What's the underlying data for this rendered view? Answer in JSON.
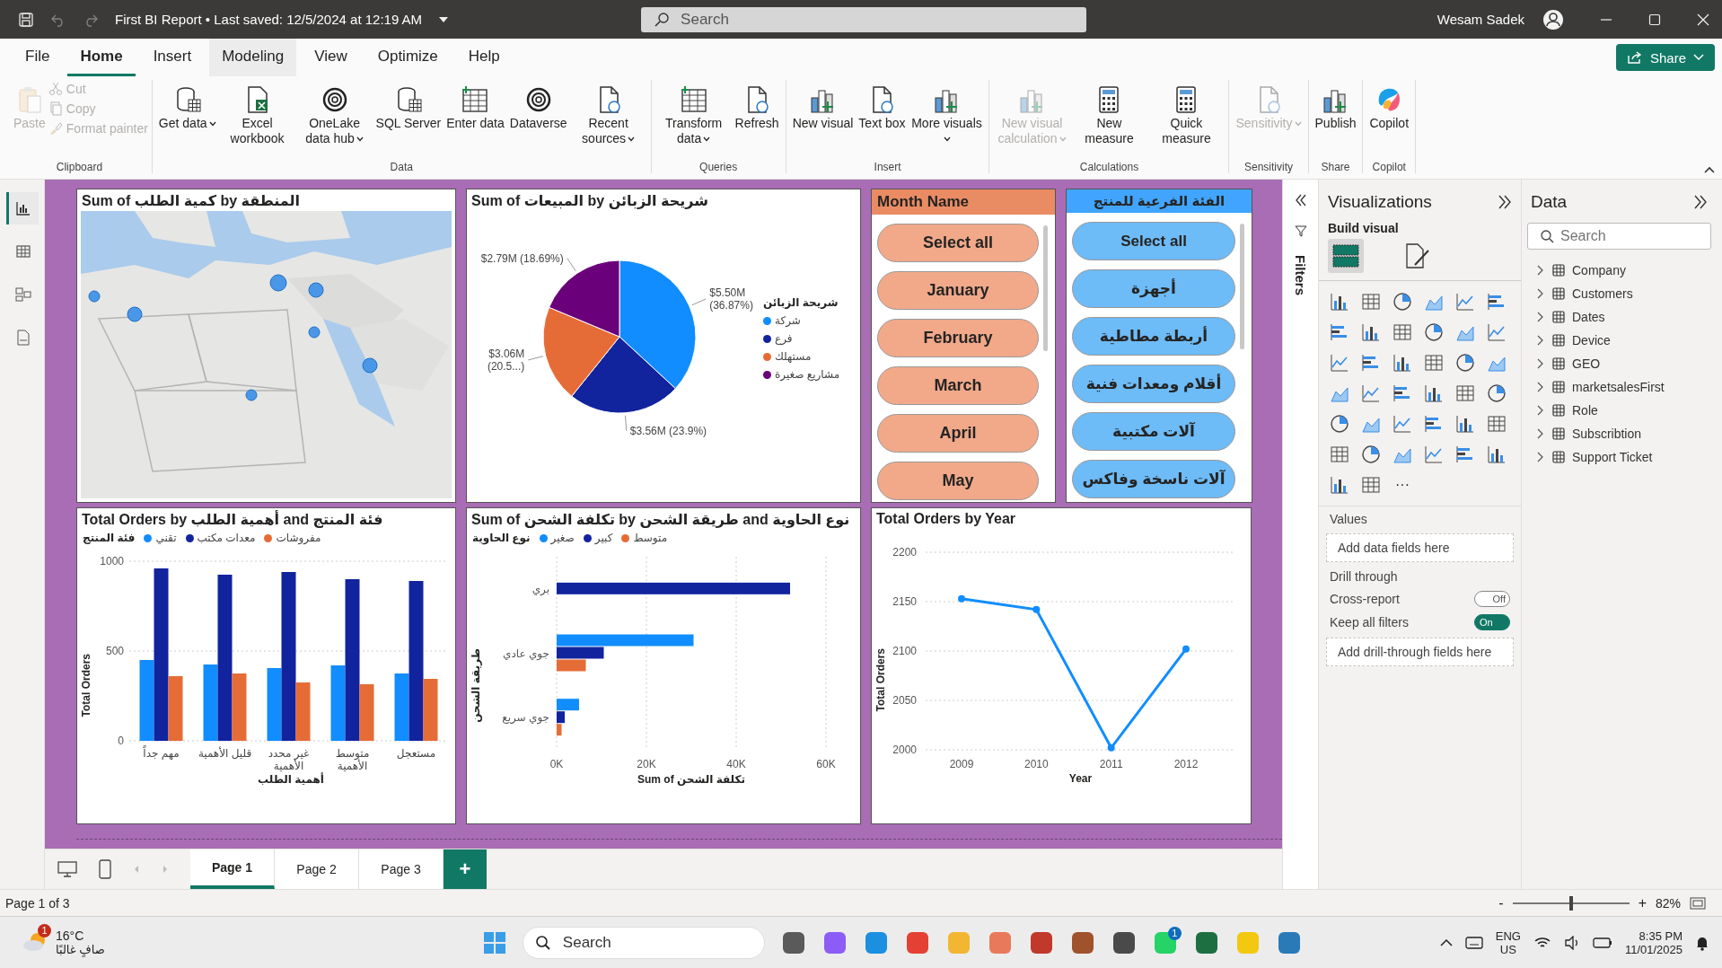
{
  "title_bar": {
    "title": "First BI Report • Last saved: 12/5/2024 at 12:19 AM",
    "search_placeholder": "Search",
    "user_name": "Wesam Sadek"
  },
  "menu_tabs": [
    {
      "label": "File",
      "selected": false,
      "hovered": false
    },
    {
      "label": "Home",
      "selected": true,
      "hovered": false
    },
    {
      "label": "Insert",
      "selected": false,
      "hovered": false
    },
    {
      "label": "Modeling",
      "selected": false,
      "hovered": true
    },
    {
      "label": "View",
      "selected": false,
      "hovered": false
    },
    {
      "label": "Optimize",
      "selected": false,
      "hovered": false
    },
    {
      "label": "Help",
      "selected": false,
      "hovered": false
    }
  ],
  "share_button": {
    "label": "Share"
  },
  "ribbon": {
    "groups": [
      {
        "label": "Clipboard",
        "items": [
          {
            "label": "Paste",
            "kind": "large",
            "disabled": true,
            "dropdown": false
          },
          {
            "label": "Cut",
            "kind": "small",
            "disabled": true
          },
          {
            "label": "Copy",
            "kind": "small",
            "disabled": true
          },
          {
            "label": "Format painter",
            "kind": "small",
            "disabled": true
          }
        ]
      },
      {
        "label": "Data",
        "items": [
          {
            "label": "Get data",
            "kind": "large",
            "disabled": false,
            "dropdown": true
          },
          {
            "label": "Excel workbook",
            "kind": "large",
            "disabled": false,
            "dropdown": false
          },
          {
            "label": "OneLake data hub",
            "kind": "large",
            "disabled": false,
            "dropdown": true
          },
          {
            "label": "SQL Server",
            "kind": "large",
            "disabled": false,
            "dropdown": false
          },
          {
            "label": "Enter data",
            "kind": "large",
            "disabled": false,
            "dropdown": false
          },
          {
            "label": "Dataverse",
            "kind": "large",
            "disabled": false,
            "dropdown": false
          },
          {
            "label": "Recent sources",
            "kind": "large",
            "disabled": false,
            "dropdown": true
          }
        ]
      },
      {
        "label": "Queries",
        "items": [
          {
            "label": "Transform data",
            "kind": "large",
            "disabled": false,
            "dropdown": true
          },
          {
            "label": "Refresh",
            "kind": "large",
            "disabled": false,
            "dropdown": false
          }
        ]
      },
      {
        "label": "Insert",
        "items": [
          {
            "label": "New visual",
            "kind": "large",
            "disabled": false,
            "dropdown": false
          },
          {
            "label": "Text box",
            "kind": "large",
            "disabled": false,
            "dropdown": false
          },
          {
            "label": "More visuals",
            "kind": "large",
            "disabled": false,
            "dropdown": true
          }
        ]
      },
      {
        "label": "Calculations",
        "items": [
          {
            "label": "New visual calculation",
            "kind": "large",
            "disabled": true,
            "dropdown": true
          },
          {
            "label": "New measure",
            "kind": "large",
            "disabled": false,
            "dropdown": false
          },
          {
            "label": "Quick measure",
            "kind": "large",
            "disabled": false,
            "dropdown": false
          }
        ]
      },
      {
        "label": "Sensitivity",
        "items": [
          {
            "label": "Sensitivity",
            "kind": "large",
            "disabled": true,
            "dropdown": true
          }
        ]
      },
      {
        "label": "Share",
        "items": [
          {
            "label": "Publish",
            "kind": "large",
            "disabled": false,
            "dropdown": false
          }
        ]
      },
      {
        "label": "Copilot",
        "items": [
          {
            "label": "Copilot",
            "kind": "large",
            "disabled": false,
            "dropdown": false
          }
        ]
      }
    ]
  },
  "left_rail": [
    {
      "selected": true
    },
    {
      "selected": false
    },
    {
      "selected": false
    },
    {
      "selected": false
    }
  ],
  "visuals": {
    "map": {
      "title": "Sum of كمية الطلب by المنطقة",
      "kind": "picture"
    },
    "pie": {
      "legend_title": "شريحة الزبائن",
      "chart_data": {
        "type": "pie",
        "title": "Sum of المبيعات by شريحة الزبائن",
        "categories": [
          "شركة",
          "فرع",
          "مستهلك",
          "مشاريع صغيرة"
        ],
        "values": [
          5500000,
          3560000,
          3060000,
          2790000
        ],
        "legend": "right",
        "colors": [
          "#118dff",
          "#12239e",
          "#e66c37",
          "#6b007b"
        ],
        "value_labels": [
          "$5.50M (36.87%)",
          "$3.56M (23.9%)",
          "$3.06M (20.5...)",
          "$2.79M (18.69%)"
        ]
      }
    },
    "month_slicer": {
      "header": "Month Name",
      "items": [
        {
          "label": "Select all",
          "selected": false
        },
        {
          "label": "January",
          "selected": false
        },
        {
          "label": "February",
          "selected": false
        },
        {
          "label": "March",
          "selected": false
        },
        {
          "label": "April",
          "selected": false
        },
        {
          "label": "May",
          "selected": false
        }
      ]
    },
    "category_slicer": {
      "header": "الفئة الفرعية للمنتج",
      "items": [
        {
          "label": "Select all",
          "selected": false
        },
        {
          "label": "أجهزة",
          "selected": false
        },
        {
          "label": "أربطة مطاطية",
          "selected": false
        },
        {
          "label": "أقلام ومعدات فنية",
          "selected": false
        },
        {
          "label": "آلات مكتبية",
          "selected": false
        },
        {
          "label": "آلات ناسخة وفاكس",
          "selected": false
        }
      ]
    },
    "bar_chart": {
      "legend_title": "فئة المنتج",
      "chart_data": {
        "type": "bar",
        "title": "Total Orders by أهمية الطلب and فئة المنتج",
        "xlabel": "أهمية الطلب",
        "ylabel": "Total Orders",
        "categories": [
          "مهم جداً",
          "قليل الأهمية",
          "غير محدد الأهمية",
          "متوسط الأهمية",
          "مستعجل"
        ],
        "series": [
          {
            "name": "تقني",
            "color": "#118dff",
            "values": [
              450,
              425,
              405,
              420,
              375
            ]
          },
          {
            "name": "معدات مكتب",
            "color": "#12239e",
            "values": [
              960,
              925,
              940,
              900,
              890
            ]
          },
          {
            "name": "مفروشات",
            "color": "#e66c37",
            "values": [
              360,
              375,
              325,
              315,
              345
            ]
          }
        ],
        "ylim": [
          0,
          1000
        ],
        "yticks": [
          0,
          500,
          1000
        ]
      }
    },
    "hbar_chart": {
      "legend_title": "نوع الحاوية",
      "chart_data": {
        "type": "bar",
        "orientation": "horizontal",
        "title": "Sum of تكلفة الشحن by طريقة الشحن and نوع الحاوية",
        "xlabel": "Sum of تكلفة الشحن",
        "ylabel": "طريقة الشحن",
        "categories": [
          "بري",
          "جوي عادي",
          "جوي سريع"
        ],
        "series": [
          {
            "name": "صغير",
            "color": "#118dff",
            "values": [
              null,
              30500,
              5000
            ]
          },
          {
            "name": "كبير",
            "color": "#12239e",
            "values": [
              52000,
              10500,
              1800
            ]
          },
          {
            "name": "متوسط",
            "color": "#e66c37",
            "values": [
              null,
              6500,
              1100
            ]
          }
        ],
        "xlim": [
          0,
          60000
        ],
        "xticks": [
          {
            "value": 0,
            "label": "0K"
          },
          {
            "value": 20000,
            "label": "20K"
          },
          {
            "value": 40000,
            "label": "40K"
          },
          {
            "value": 60000,
            "label": "60K"
          }
        ]
      }
    },
    "line_chart": {
      "chart_data": {
        "type": "line",
        "title": "Total Orders by Year",
        "xlabel": "Year",
        "ylabel": "Total Orders",
        "x": [
          "2009",
          "2010",
          "2011",
          "2012"
        ],
        "series": [
          {
            "color": "#118dff",
            "values": [
              2153,
              2142,
              2002,
              2102
            ]
          }
        ],
        "ylim": [
          2000,
          2200
        ],
        "yticks": [
          2000,
          2050,
          2100,
          2150,
          2200
        ],
        "grid": true,
        "marker": true
      }
    }
  },
  "filters_pane": {
    "label": "Filters"
  },
  "visualizations_pane": {
    "title": "Visualizations",
    "section": "Build visual",
    "build_tabs": [
      {
        "selected": true
      },
      {
        "selected": false
      }
    ],
    "more": "···",
    "values_label": "Values",
    "values_placeholder": "Add data fields here",
    "drill_label": "Drill through",
    "toggles": [
      {
        "label": "Cross-report",
        "on": false,
        "state_text": "Off"
      },
      {
        "label": "Keep all filters",
        "on": true,
        "state_text": "On"
      }
    ],
    "drill_placeholder": "Add drill-through fields here"
  },
  "data_pane": {
    "title": "Data",
    "search_placeholder": "Search",
    "tables": [
      {
        "name": "Company",
        "expanded": false
      },
      {
        "name": "Customers",
        "expanded": false
      },
      {
        "name": "Dates",
        "expanded": false
      },
      {
        "name": "Device",
        "expanded": false
      },
      {
        "name": "GEO",
        "expanded": false
      },
      {
        "name": "marketsalesFirst",
        "expanded": false
      },
      {
        "name": "Role",
        "expanded": false
      },
      {
        "name": "Subscribtion",
        "expanded": false
      },
      {
        "name": "Support Ticket",
        "expanded": false
      }
    ]
  },
  "page_tabs": [
    {
      "label": "Page 1",
      "selected": true
    },
    {
      "label": "Page 2",
      "selected": false
    },
    {
      "label": "Page 3",
      "selected": false
    }
  ],
  "add_page": "+",
  "status_bar": {
    "page": "Page 1 of 3",
    "zoom_out": "-",
    "zoom_in": "+",
    "zoom_slider": {
      "level": 0.5
    },
    "zoom": "82%"
  },
  "taskbar": {
    "weather": {
      "temp": "16°C",
      "condition": "صافٍ غالبًا",
      "badge": "1"
    },
    "search_placeholder": "Search",
    "apps": [
      {
        "color": "#5a5a5a"
      },
      {
        "color": "#8b5cf6"
      },
      {
        "color": "#1b8fe0"
      },
      {
        "color": "#e44134"
      },
      {
        "color": "#f2b632"
      },
      {
        "color": "#e8795a"
      },
      {
        "color": "#c0392b"
      },
      {
        "color": "#a0522d"
      },
      {
        "color": "#4a4a4a"
      },
      {
        "color": "#25d366",
        "badge": "1"
      },
      {
        "color": "#1d6f42"
      },
      {
        "color": "#f2c811"
      },
      {
        "color": "#2a7ab8"
      }
    ],
    "language": "ENG",
    "region": "US",
    "time": "8:35 PM",
    "date": "11/01/2025"
  }
}
